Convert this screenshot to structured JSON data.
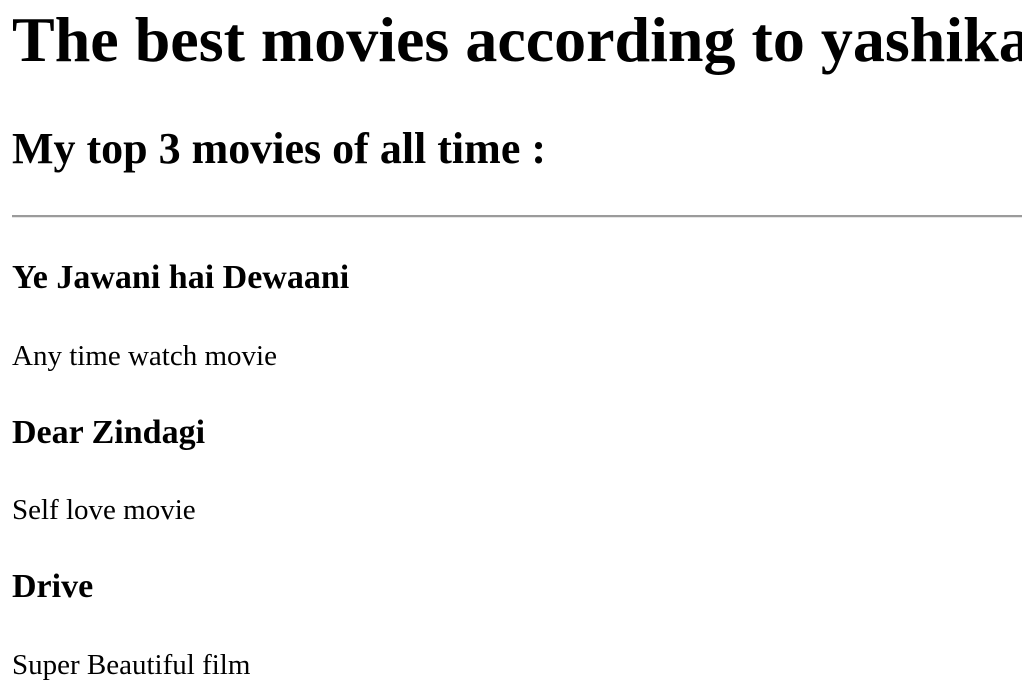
{
  "page": {
    "title": "The best movies according to yashika",
    "subtitle": "My top 3 movies of all time :"
  },
  "movies": [
    {
      "title": "Ye Jawani hai Dewaani",
      "description": "Any time watch movie"
    },
    {
      "title": "Dear Zindagi",
      "description": "Self love movie"
    },
    {
      "title": "Drive",
      "description": "Super Beautiful film"
    }
  ]
}
